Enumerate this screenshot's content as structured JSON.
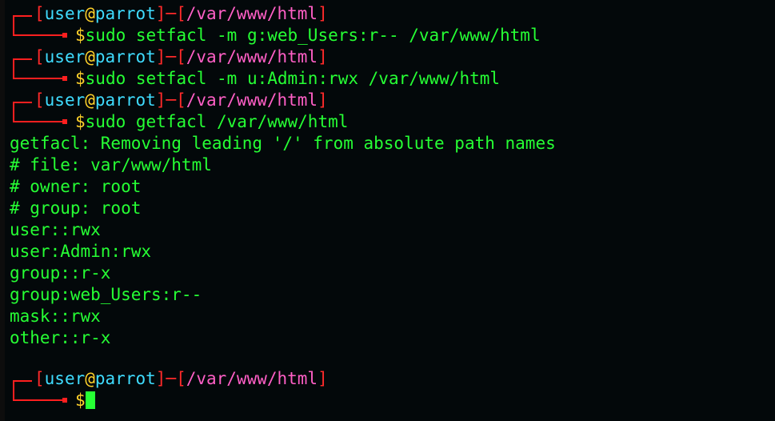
{
  "prompt": {
    "user": "user",
    "at": "@",
    "host": "parrot",
    "sep_open": "[",
    "sep_close": "]",
    "dash": "─",
    "path": "/var/www/html",
    "dollar": "$"
  },
  "commands": [
    "sudo setfacl -m g:web_Users:r-- /var/www/html",
    "sudo setfacl -m u:Admin:rwx /var/www/html",
    "sudo getfacl /var/www/html"
  ],
  "output": [
    "getfacl: Removing leading '/' from absolute path names",
    "# file: var/www/html",
    "# owner: root",
    "# group: root",
    "user::rwx",
    "user:Admin:rwx",
    "group::r-x",
    "group:web_Users:r--",
    "mask::rwx",
    "other::r-x"
  ],
  "colors": {
    "background": "#03080a",
    "text": "#26ff34",
    "frame": "#ff1f1f",
    "user": "#3fdcff",
    "at": "#ffd22b",
    "path": "#ff5fc6"
  }
}
